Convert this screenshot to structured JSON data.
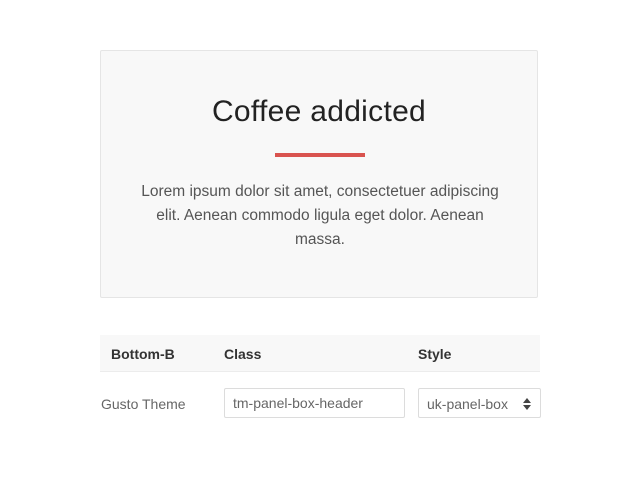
{
  "panel": {
    "title": "Coffee addicted",
    "body": "Lorem ipsum dolor sit amet, consectetuer adipiscing elit. Aenean commodo ligula eget dolor. Aenean massa.",
    "accent_color": "#d9534f"
  },
  "table": {
    "headers": [
      "Bottom-B",
      "Class",
      "Style"
    ],
    "rows": [
      {
        "label": "Gusto Theme",
        "class_value": "tm-panel-box-header",
        "style_value": "uk-panel-box"
      }
    ]
  },
  "icons": {
    "select_arrows": "up-down-chevron-icon"
  }
}
